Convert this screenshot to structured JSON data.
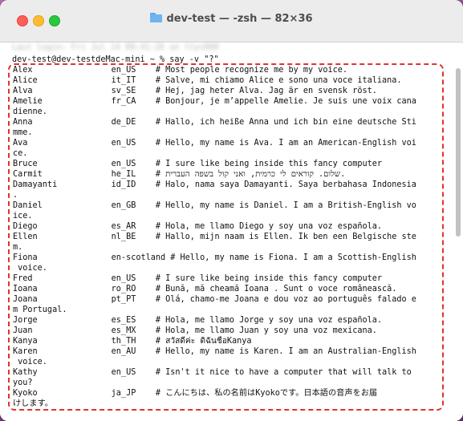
{
  "window": {
    "title": "dev-test — -zsh — 82×36"
  },
  "terminal": {
    "previous_line": "Last login: Fri Jul 14 09:41:26 on ttys000",
    "prompt": "dev-test@dev-testdeMac-mini ~ % say -v \"?\"",
    "lines": [
      "Alex                en_US    # Most people recognize me by my voice.",
      "Alice               it_IT    # Salve, mi chiamo Alice e sono una voce italiana.",
      "Alva                sv_SE    # Hej, jag heter Alva. Jag är en svensk röst.",
      "Amelie              fr_CA    # Bonjour, je m’appelle Amelie. Je suis une voix cana",
      "dienne.",
      "Anna                de_DE    # Hallo, ich heiße Anna und ich bin eine deutsche Sti",
      "mme.",
      "Ava                 en_US    # Hello, my name is Ava. I am an American-English voi",
      "ce.",
      "Bruce               en_US    # I sure like being inside this fancy computer",
      "Carmit              he_IL    # שלום. קוראים לי כרמית, ואני קול בשפה העברית.",
      "Damayanti           id_ID    # Halo, nama saya Damayanti. Saya berbahasa Indonesia",
      ".",
      "Daniel              en_GB    # Hello, my name is Daniel. I am a British-English vo",
      "ice.",
      "Diego               es_AR    # Hola, me llamo Diego y soy una voz española.",
      "Ellen               nl_BE    # Hallo, mijn naam is Ellen. Ik ben een Belgische ste",
      "m.",
      "Fiona               en-scotland # Hello, my name is Fiona. I am a Scottish-English",
      " voice.",
      "Fred                en_US    # I sure like being inside this fancy computer",
      "Ioana               ro_RO    # Bună, mă cheamă Ioana . Sunt o voce românească.",
      "Joana               pt_PT    # Olá, chamo-me Joana e dou voz ao português falado e",
      "m Portugal.",
      "Jorge               es_ES    # Hola, me llamo Jorge y soy una voz española.",
      "Juan                es_MX    # Hola, me llamo Juan y soy una voz mexicana.",
      "Kanya               th_TH    # สวัสดีค่ะ ดิฉันชื่อKanya",
      "Karen               en_AU    # Hello, my name is Karen. I am an Australian-English",
      " voice.",
      "Kathy               en_US    # Isn't it nice to have a computer that will talk to",
      "you?",
      "Kyoko               ja_JP    # こんにちは、私の名前はKyokoです。日本語の音声をお届",
      "けします。"
    ]
  }
}
